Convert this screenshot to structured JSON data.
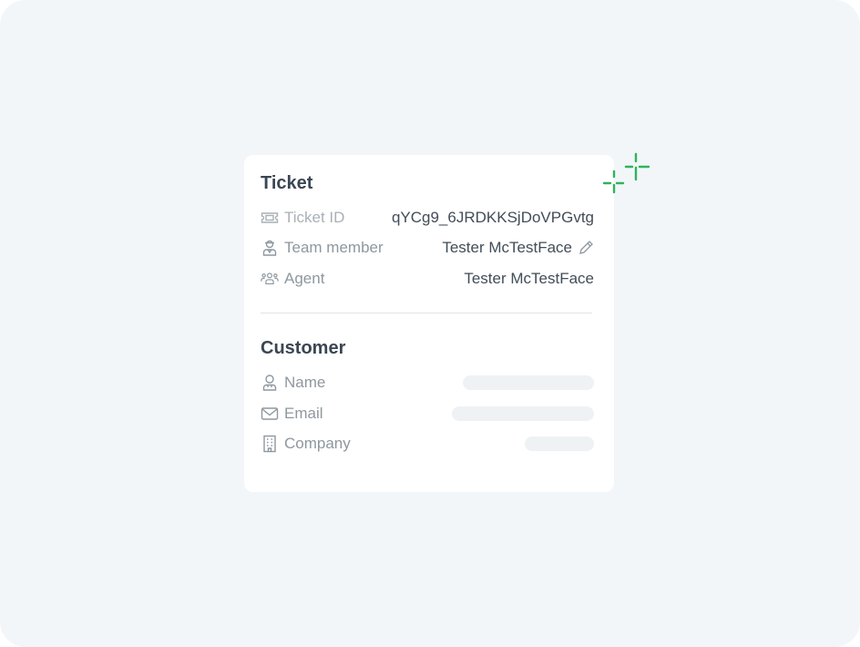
{
  "ticket": {
    "title": "Ticket",
    "rows": [
      {
        "label": "Ticket ID",
        "value": "qYCg9_6JRDKKSjDoVPGvtg",
        "icon": "ticket-icon"
      },
      {
        "label": "Team member",
        "value": "Tester McTestFace",
        "icon": "team-member-icon",
        "editable": true
      },
      {
        "label": "Agent",
        "value": "Tester McTestFace",
        "icon": "agents-icon"
      }
    ]
  },
  "customer": {
    "title": "Customer",
    "rows": [
      {
        "label": "Name",
        "icon": "person-icon",
        "loading": true
      },
      {
        "label": "Email",
        "icon": "envelope-icon",
        "loading": true
      },
      {
        "label": "Company",
        "icon": "building-icon",
        "loading": true
      }
    ]
  },
  "colors": {
    "background": "#f2f6f9",
    "card": "#ffffff",
    "heading": "#3a4652",
    "label": "#8e979f",
    "value": "#424d58",
    "skeleton": "#eef2f5",
    "sparkle": "#2fb35c"
  }
}
